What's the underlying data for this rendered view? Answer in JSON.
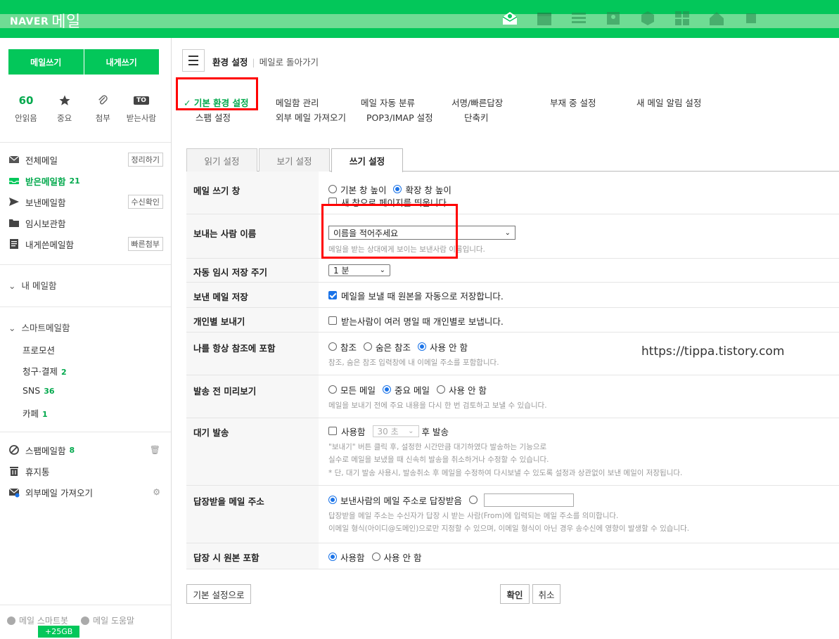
{
  "topbar": {
    "brand": "NAVER",
    "service": "메일",
    "color": "#03c75a",
    "icons": [
      "envelope-open-icon",
      "calendar-icon",
      "list-icon",
      "contacts-icon",
      "hexagon-icon",
      "grid-icon",
      "home-icon",
      "square-icon"
    ]
  },
  "sidebar": {
    "write_label": "메일쓰기",
    "write_self_label": "내게쓰기",
    "quick": [
      {
        "value": "60",
        "label": "안읽음"
      },
      {
        "icon": "star-icon",
        "label": "중요"
      },
      {
        "icon": "paperclip-icon",
        "label": "첨부"
      },
      {
        "icon": "to-icon",
        "badge": "TO",
        "label": "받는사람"
      }
    ],
    "folders": {
      "all": {
        "label": "전체메일",
        "button": "정리하기"
      },
      "inbox": {
        "label": "받은메일함",
        "count": "21"
      },
      "sent": {
        "label": "보낸메일함",
        "button": "수신확인"
      },
      "drafts": {
        "label": "임시보관함"
      },
      "self": {
        "label": "내게쓴메일함",
        "button": "빠른첨부"
      }
    },
    "my_mailbox": "내 메일함",
    "smart": {
      "header": "스마트메일함",
      "items": [
        {
          "label": "프로모션",
          "count": ""
        },
        {
          "label": "청구·결제",
          "count": "2"
        },
        {
          "label": "SNS",
          "count": "36"
        },
        {
          "label": "카페",
          "count": "1"
        }
      ]
    },
    "spam": {
      "label": "스팸메일함",
      "count": "8"
    },
    "trash": {
      "label": "휴지통"
    },
    "external": {
      "label": "외부메일 가져오기"
    },
    "bottom": {
      "smart_label": "메일 스마트봇",
      "help_label": "메일 도움말",
      "storage": "+25GB"
    }
  },
  "main": {
    "breadcrumb": {
      "current": "환경 설정",
      "back": "메일로 돌아가기"
    },
    "menu": {
      "basic": "✓ 기본 환경 설정",
      "mailbox": "메일함 관리",
      "auto_sort": "메일 자동 분류",
      "signature": "서명/빠른답장",
      "away": "부재 중 설정",
      "new_alert": "새 메일 알림 설정",
      "spam": "스팸 설정",
      "external": "외부 메일 가져오기",
      "pop3": "POP3/IMAP 설정",
      "shortcut": "단축키"
    },
    "tabs": {
      "read": "읽기 설정",
      "view": "보기 설정",
      "write": "쓰기 설정"
    },
    "rows": {
      "window": {
        "label": "메일 쓰기 창",
        "opt1": "기본 창 높이",
        "opt2": "확장 창 높이",
        "check": "새 창으로 페이지를 띄웁니다."
      },
      "sender": {
        "label": "보내는 사람 이름",
        "select": "이름을 적어주세요",
        "help": "메일을 받는 상대에게 보이는 보낸사람 이름입니다."
      },
      "autosave": {
        "label": "자동 임시 저장 주기",
        "select": "1 분"
      },
      "savesent": {
        "label": "보낸 메일 저장",
        "check": "메일을 보낼 때 원본을 자동으로 저장합니다."
      },
      "individual": {
        "label": "개인별 보내기",
        "check": "받는사람이 여러 명일 때 개인별로 보냅니다."
      },
      "cc": {
        "label": "나를 항상 참조에 포함",
        "opt1": "참조",
        "opt2": "숨은 참조",
        "opt3": "사용 안 함",
        "help": "참조, 숨은 참조 입력창에 내 이메일 주소를 포함합니다."
      },
      "preview": {
        "label": "발송 전 미리보기",
        "opt1": "모든 메일",
        "opt2": "중요 메일",
        "opt3": "사용 안 함",
        "help": "메일을 보내기 전에 주요 내용을 다시 한 번 검토하고 보낼 수 있습니다."
      },
      "delay": {
        "label": "대기 발송",
        "check": "사용함",
        "select": "30 초",
        "suffix": "후 발송",
        "help1": "\"보내기\" 버튼 클릭 후, 설정한 시간만큼 대기하였다 발송하는 기능으로",
        "help2": "실수로 메일을 보냈을 때 신속히 발송을 취소하거나 수정할 수 있습니다.",
        "help3": "* 단, 대기 발송 사용시, 발송취소 후 메일을 수정하여 다시보낼 수 있도록 설정과 상관없이 보낸 메일이 저장됩니다."
      },
      "replyto": {
        "label": "답장받을 메일 주소",
        "opt1": "보낸사람의 메일 주소로 답장받음",
        "help1": "답장받을 메일 주소는 수신자가 답장 시 받는 사람(From)에 입력되는 메일 주소를 의미합니다.",
        "help2": "이메일 형식(아이디@도메인)으로만 지정할 수 있으며, 이메일 형식이 아닌 경우 송수신에 영향이 발생할 수 있습니다."
      },
      "include": {
        "label": "답장 시 원본 포함",
        "opt1": "사용함",
        "opt2": "사용 안 함"
      }
    },
    "watermark": "https://tippa.tistory.com",
    "buttons": {
      "reset": "기본 설정으로",
      "ok": "확인",
      "cancel": "취소"
    }
  }
}
